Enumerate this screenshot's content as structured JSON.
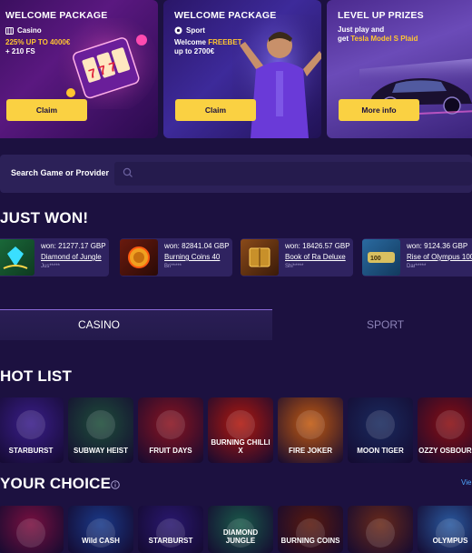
{
  "promos": [
    {
      "title": "WELCOME PACKAGE",
      "tag": "Casino",
      "text_hl": "225% UP TO 4000€",
      "text_rest": "+ 210 FS",
      "button": "Claim"
    },
    {
      "title": "WELCOME PACKAGE",
      "tag": "Sport",
      "text_line1": "Welcome ",
      "text_hl": "FREEBET",
      "text_line2": "up to 2700€",
      "button": "Claim"
    },
    {
      "title": "LEVEL UP PRIZES",
      "text_line1": "Just play and",
      "text_line2": "get ",
      "text_hl": "Tesla Model S Plaid",
      "button": "More info"
    }
  ],
  "search": {
    "label": "Search Game or Provider",
    "placeholder": ""
  },
  "just_won": {
    "title": "JUST WON!",
    "items": [
      {
        "amount": "won: 21277.17 GBP",
        "game": "Diamond of Jungle",
        "user": "Jus*****"
      },
      {
        "amount": "won: 82841.04 GBP",
        "game": "Burning Coins 40",
        "user": "Bri*****"
      },
      {
        "amount": "won: 18426.57 GBP",
        "game": "Book of Ra Deluxe",
        "user": "Shi*****"
      },
      {
        "amount": "won: 9124.36 GBP",
        "game": "Rise of Olympus 100",
        "user": "Dar*****"
      }
    ]
  },
  "tabs": {
    "casino": "CASINO",
    "sport": "SPORT"
  },
  "hot_list": {
    "title": "HOT LIST",
    "games": [
      {
        "name": "STARBURST",
        "color": "#3a1e8a"
      },
      {
        "name": "SUBWAY HEIST",
        "color": "#1e4d3a"
      },
      {
        "name": "FRUIT DAYS",
        "color": "#8a1420"
      },
      {
        "name": "BURNING CHILLI X",
        "color": "#b0180e"
      },
      {
        "name": "FIRE JOKER",
        "color": "#c25a10"
      },
      {
        "name": "MOON TIGER",
        "color": "#1a2a5e"
      },
      {
        "name": "OZZY OSBOURNE",
        "color": "#8a0e12"
      }
    ]
  },
  "your_choice": {
    "title": "YOUR CHOICE",
    "view_all": "Vie",
    "games": [
      {
        "name": "",
        "color": "#7a1040"
      },
      {
        "name": "Wild CASH",
        "color": "#1a3a8a"
      },
      {
        "name": "STARBURST",
        "color": "#2a1870"
      },
      {
        "name": "DIAMOND JUNGLE",
        "color": "#1a5a4a"
      },
      {
        "name": "BURNING COINS",
        "color": "#5a1a0e"
      },
      {
        "name": "",
        "color": "#6a2a1a"
      },
      {
        "name": "OLYMPUS",
        "color": "#2a5aa0"
      }
    ]
  },
  "colors": {
    "accent": "#fad142",
    "bg": "#1c1140",
    "link": "#4fa8ff"
  }
}
